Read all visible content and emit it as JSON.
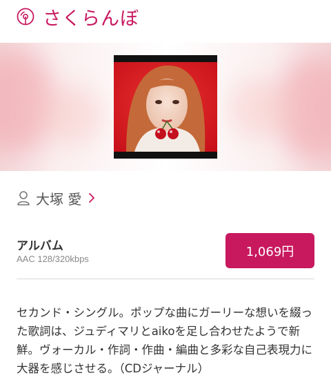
{
  "header": {
    "title": "さくらんぼ",
    "icon": "disc-icon",
    "accent": "#c8195f"
  },
  "artist": {
    "name": "大塚 愛",
    "icon": "person-icon"
  },
  "product": {
    "type_label": "アルバム",
    "format": "AAC 128/320kbps",
    "price_label": "1,069円"
  },
  "description": "セカンド・シングル。ポップな曲にガーリーな想いを綴った歌詞は、ジュディマリとaikoを足し合わせたようで新鮮。ヴォーカル・作詞・作曲・編曲と多彩な自己表現力に大器を感じさせる。（CDジャーナル）"
}
